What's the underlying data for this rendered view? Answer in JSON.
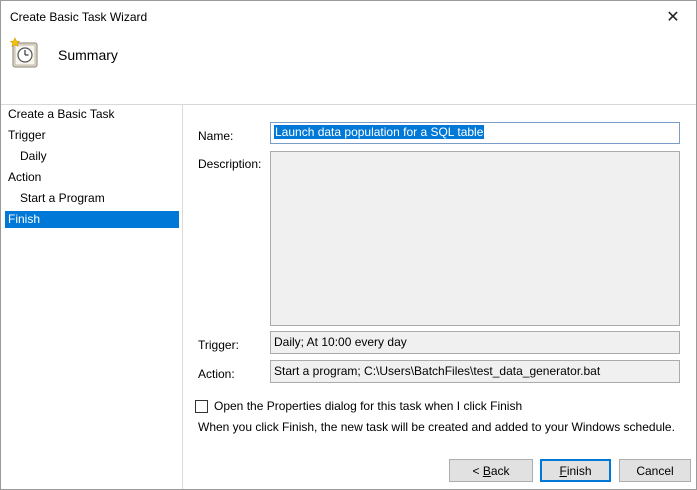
{
  "window": {
    "title": "Create Basic Task Wizard",
    "close_glyph": "✕"
  },
  "header": {
    "title": "Summary"
  },
  "sidebar": {
    "items": [
      {
        "label": "Create a Basic Task"
      },
      {
        "label": "Trigger"
      },
      {
        "label": "Daily"
      },
      {
        "label": "Action"
      },
      {
        "label": "Start a Program"
      },
      {
        "label": "Finish"
      }
    ]
  },
  "form": {
    "name_label": "Name:",
    "name_value": "Launch data population for a SQL table",
    "description_label": "Description:",
    "description_value": "",
    "trigger_label": "Trigger:",
    "trigger_value": "Daily; At 10:00 every day",
    "action_label": "Action:",
    "action_value": "Start a program; C:\\Users\\BatchFiles\\test_data_generator.bat",
    "checkbox_label": "Open the Properties dialog for this task when I click Finish",
    "checkbox_checked": false,
    "info_text": "When you click Finish, the new task will be created and added to your Windows schedule."
  },
  "buttons": {
    "back_prefix": "< ",
    "back_mnemonic": "B",
    "back_rest": "ack",
    "finish_mnemonic": "F",
    "finish_rest": "inish",
    "cancel": "Cancel"
  },
  "colors": {
    "selection": "#0078d7",
    "readonly_bg": "#f0f0f0",
    "button_bg": "#e1e1e1"
  }
}
